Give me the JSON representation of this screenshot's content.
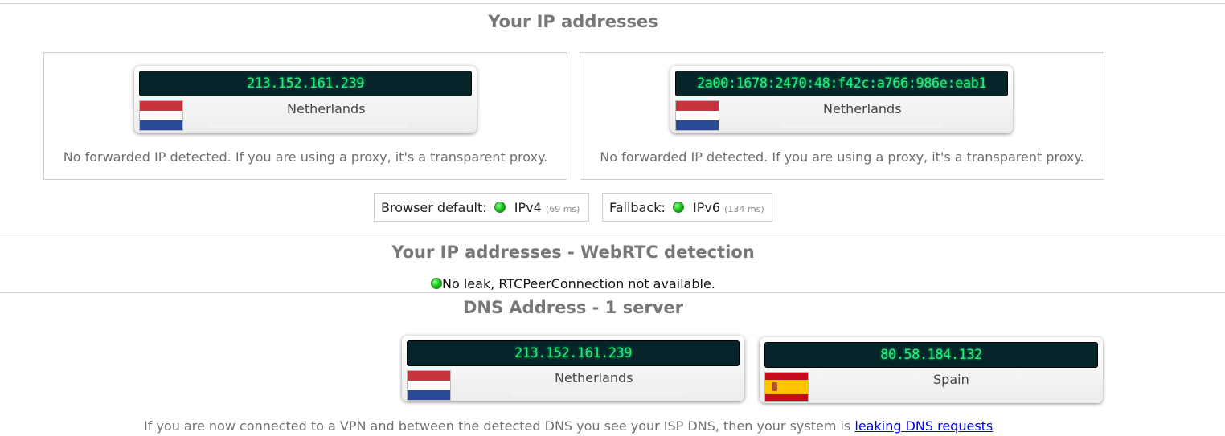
{
  "ip_section": {
    "title": "Your IP addresses",
    "cards": [
      {
        "ip": "213.152.161.239",
        "country": "Netherlands",
        "flag": "nl-flag",
        "note": "No forwarded IP detected. If you are using a proxy, it's a transparent proxy."
      },
      {
        "ip": "2a00:1678:2470:48:f42c:a766:986e:eab1",
        "country": "Netherlands",
        "flag": "nl-flag",
        "note": "No forwarded IP detected. If you are using a proxy, it's a transparent proxy."
      }
    ],
    "browser_default": {
      "label": "Browser default:",
      "protocol": "IPv4",
      "latency": "(69 ms)",
      "status_color": "#0cbe0c"
    },
    "fallback": {
      "label": "Fallback:",
      "protocol": "IPv6",
      "latency": "(134 ms)",
      "status_color": "#0cbe0c"
    }
  },
  "webrtc_section": {
    "title": "Your IP addresses - WebRTC detection",
    "status": "No leak, RTCPeerConnection not available."
  },
  "dns_section": {
    "title": "DNS Address - 1 server",
    "servers": [
      {
        "ip": "213.152.161.239",
        "country": "Netherlands",
        "flag": "nl-flag"
      },
      {
        "ip": "80.58.184.132",
        "country": "Spain",
        "flag": "es-flag"
      }
    ],
    "note_prefix": "If you are now connected to a VPN and between the detected DNS you see your ISP DNS, then your system is",
    "note_link": "leaking DNS requests"
  },
  "colors": {
    "lcd_bg": "#062429",
    "lcd_text": "#22f07a",
    "ok_green": "#0cbe0c",
    "link": "#0000ee"
  }
}
